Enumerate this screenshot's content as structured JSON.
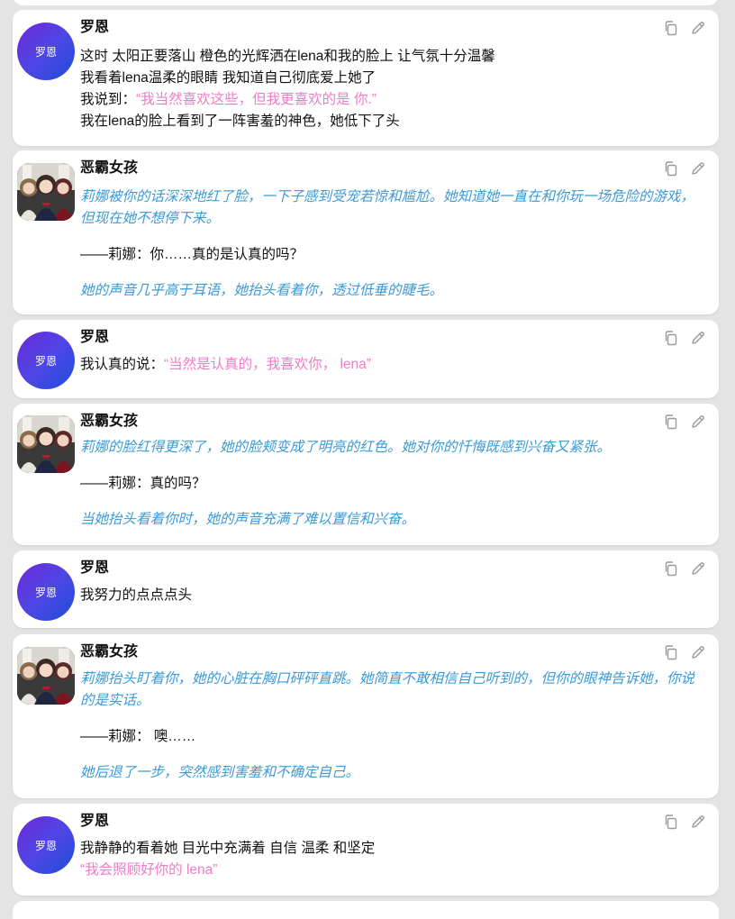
{
  "colors": {
    "narration": "#3b9ad6",
    "quote": "#f07cc7",
    "background": "#e4e4e4"
  },
  "icons": {
    "copy": "copy-icon",
    "edit": "pencil-icon"
  },
  "messages": [
    {
      "speaker": "罗恩",
      "avatar_text": "罗恩",
      "lines": [
        "这时 太阳正要落山 橙色的光辉洒在lena和我的脸上 让气氛十分温馨",
        "我看着lena温柔的眼睛 我知道自己彻底爱上她了"
      ],
      "said_prefix": "我说到：",
      "said_quote": "“我当然喜欢这些，但我更喜欢的是 你.”",
      "last_line": "我在lena的脸上看到了一阵害羞的神色，她低下了头"
    },
    {
      "speaker": "恶霸女孩",
      "narration1": "莉娜被你的话深深地红了脸，一下子感到受宠若惊和尴尬。她知道她一直在和你玩一场危险的游戏，但现在她不想停下来。",
      "dialogue": "——莉娜：你……真的是认真的吗？",
      "narration2": "她的声音几乎高于耳语，她抬头看着你，透过低垂的睫毛。"
    },
    {
      "speaker": "罗恩",
      "avatar_text": "罗恩",
      "prefix": "我认真的说：",
      "quote": "“当然是认真的，我喜欢你， lena”"
    },
    {
      "speaker": "恶霸女孩",
      "narration1": "莉娜的脸红得更深了，她的脸颊变成了明亮的红色。她对你的忏悔既感到兴奋又紧张。",
      "dialogue": "——莉娜：真的吗？",
      "narration2": "当她抬头看着你时，她的声音充满了难以置信和兴奋。"
    },
    {
      "speaker": "罗恩",
      "avatar_text": "罗恩",
      "text": "我努力的点点点头"
    },
    {
      "speaker": "恶霸女孩",
      "narration1": "莉娜抬头盯着你，她的心脏在胸口砰砰直跳。她简直不敢相信自己听到的，但你的眼神告诉她，你说的是实话。",
      "dialogue": "——莉娜： 噢……",
      "narration2": "她后退了一步，突然感到害羞和不确定自己。"
    },
    {
      "speaker": "罗恩",
      "avatar_text": "罗恩",
      "text": "我静静的看着她 目光中充满着 自信 温柔 和坚定",
      "quote": "“我会照顾好你的 lena”"
    }
  ]
}
